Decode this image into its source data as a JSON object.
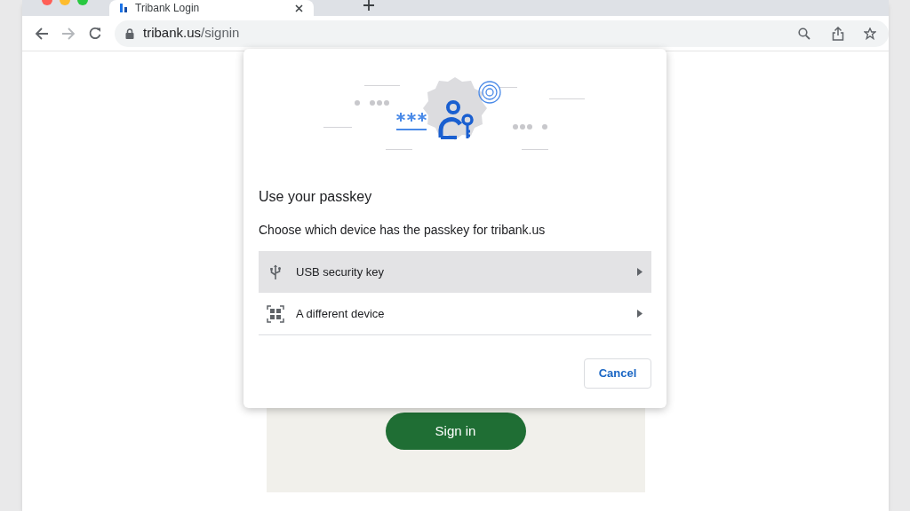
{
  "browser": {
    "tab": {
      "title": "Tribank Login",
      "selected": true
    },
    "url": {
      "host": "tribank.us",
      "path": "/signin"
    }
  },
  "dialog": {
    "title": "Use your passkey",
    "subtitle": "Choose which device has the passkey for tribank.us",
    "options": [
      {
        "kind": "usb",
        "label": "USB security key",
        "selected": true
      },
      {
        "kind": "device",
        "label": "A different device",
        "selected": false
      }
    ],
    "buttons": [
      "Cancel"
    ]
  },
  "page": {
    "button": "Sign in"
  }
}
